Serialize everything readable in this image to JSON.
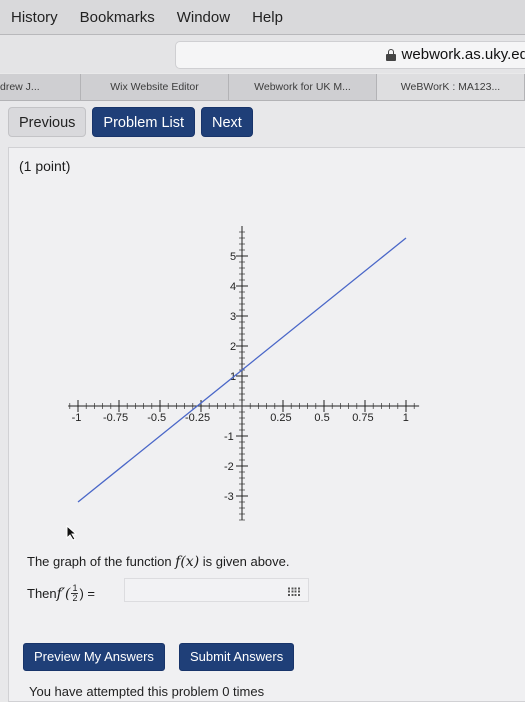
{
  "menu": [
    "History",
    "Bookmarks",
    "Window",
    "Help"
  ],
  "url": "webwork.as.uky.ed",
  "tabs": [
    "drew J...",
    "Wix Website Editor",
    "Webwork for UK M...",
    "WeBWorK : MA123..."
  ],
  "nav": {
    "previous": "Previous",
    "problem_list": "Problem List",
    "next": "Next"
  },
  "problem": {
    "points": "(1 point)",
    "statement_pre": "The graph of the function ",
    "statement_fn": "f(x)",
    "statement_post": " is given above.",
    "then": "Then ",
    "deriv": "f′(",
    "frac_num": "1",
    "frac_den": "2",
    "deriv_close": ") =",
    "answer_value": ""
  },
  "buttons": {
    "preview": "Preview My Answers",
    "submit": "Submit Answers"
  },
  "attempted": "You have attempted this problem 0 times",
  "chart_data": {
    "type": "line",
    "x_ticks": [
      "-1",
      "-0.75",
      "-0.5",
      "-0.25",
      "0.25",
      "0.5",
      "0.75",
      "1"
    ],
    "y_ticks": [
      "5",
      "4",
      "3",
      "2",
      "1",
      "-1",
      "-2",
      "-3"
    ],
    "x_range": [
      -1,
      1
    ],
    "y_range": [
      -3,
      5
    ],
    "series": [
      {
        "x": [
          -1,
          1
        ],
        "y": [
          -3.2,
          5.6
        ]
      }
    ],
    "line_color": "#4a67c8"
  }
}
